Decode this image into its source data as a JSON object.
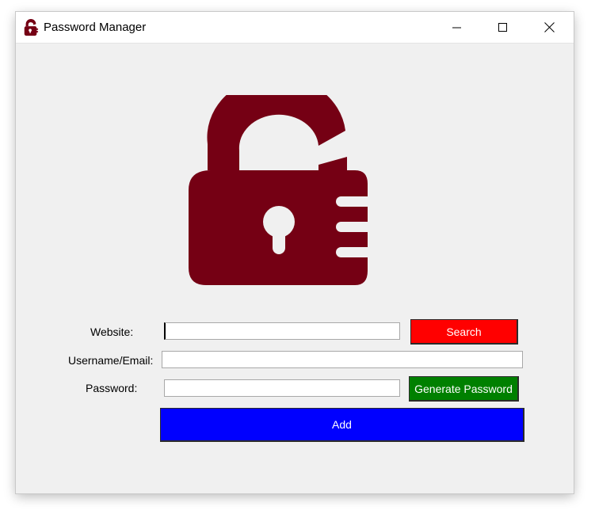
{
  "window": {
    "title": "Password Manager",
    "icon": "lock-icon",
    "controls": {
      "minimize": "minimize-icon",
      "maximize": "maximize-icon",
      "close": "close-icon"
    }
  },
  "logo": {
    "icon": "unlocked-padlock-icon",
    "color": "#750014"
  },
  "form": {
    "website": {
      "label": "Website:",
      "value": "",
      "placeholder": ""
    },
    "username": {
      "label": "Username/Email:",
      "value": "",
      "placeholder": ""
    },
    "password": {
      "label": "Password:",
      "value": "",
      "placeholder": ""
    }
  },
  "buttons": {
    "search": {
      "label": "Search",
      "color": "#ff0000"
    },
    "generate": {
      "label": "Generate Password",
      "color": "#008000"
    },
    "add": {
      "label": "Add",
      "color": "#0000ff"
    }
  }
}
